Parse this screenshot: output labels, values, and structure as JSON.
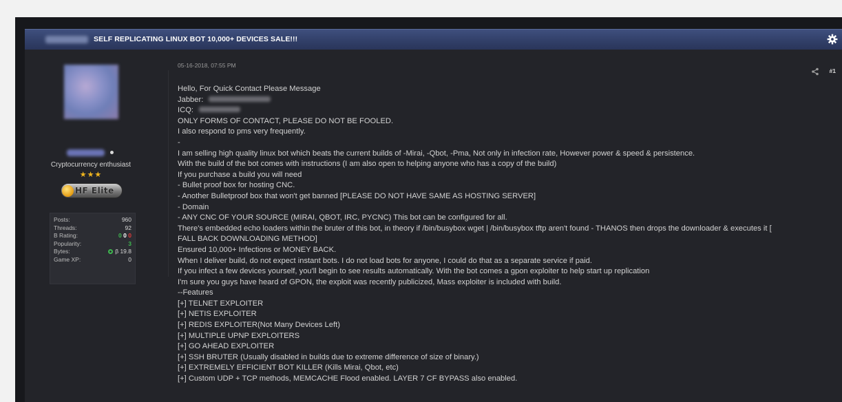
{
  "thread": {
    "title": "SELF REPLICATING LINUX BOT 10,000+ DEVICES SALE!!!"
  },
  "user": {
    "usertitle": "Cryptocurrency enthusiast",
    "stars": "★★★",
    "badge_text": "HF Elite",
    "stats": [
      {
        "label": "Posts:",
        "value": "960"
      },
      {
        "label": "Threads:",
        "value": "92"
      },
      {
        "label": "B Rating:",
        "value": ""
      },
      {
        "label": "Popularity:",
        "value": "3"
      },
      {
        "label": "Bytes:",
        "value": "β 19.8"
      },
      {
        "label": "Game XP:",
        "value": "0"
      }
    ],
    "rating": {
      "positive": "0",
      "neutral": "0",
      "negative": "0"
    }
  },
  "post": {
    "date": "05-16-2018, 07:55 PM",
    "number": "#1",
    "lines": [
      "Hello, For Quick Contact Please Message",
      "Jabber:",
      "ICQ:",
      "ONLY FORMS OF CONTACT, PLEASE DO NOT BE FOOLED.",
      "I also respond to pms very frequently.",
      "-",
      "I am selling high quality linux bot which beats the current builds of -Mirai, -Qbot, -Pma, Not only in infection rate, However power & speed & persistence.",
      "With the build of the bot comes with instructions (I am also open to helping anyone who has  a copy of the build)",
      "If you purchase a build you will need",
      "- Bullet proof box for hosting CNC.",
      "- Another Bulletproof box that won't get banned [PLEASE DO NOT HAVE SAME AS HOSTING SERVER]",
      "- Domain",
      "- ANY CNC OF YOUR SOURCE (MIRAI, QBOT, IRC, PYCNC) This bot can be configured for all.",
      "There's embedded echo loaders within the bruter of this bot, in theory if /bin/busybox wget | /bin/busybox tftp aren't found - THANOS then drops the downloader & executes it [",
      "FALL BACK DOWNLOADING METHOD]",
      "Ensured 10,000+ Infections or MONEY BACK.",
      "When I deliver build, do not expect instant bots. I do not load bots for anyone, I could do that as a separate service if paid.",
      "If you infect a few devices yourself, you'll begin to see results automatically. With the bot comes a gpon exploiter to help start up replication",
      "I'm sure you guys have heard of GPON, the exploit was recently publicized, Mass exploiter is included with build.",
      "--Features",
      "[+] TELNET EXPLOITER",
      "[+] NETIS EXPLOITER",
      "[+] REDIS EXPLOITER(Not Many Devices Left)",
      "[+] MULTIPLE UPNP EXPLOITERS",
      "[+] GO AHEAD EXPLOITER",
      "[+] SSH BRUTER (Usually disabled in builds due to extreme difference of size of binary.)",
      "[+] EXTREMELY EFFICIENT BOT KILLER (Kills Mirai, Qbot, etc)",
      "[+] Custom UDP + TCP methods, MEMCACHE Flood enabled. LAYER 7 CF BYPASS also enabled."
    ]
  }
}
